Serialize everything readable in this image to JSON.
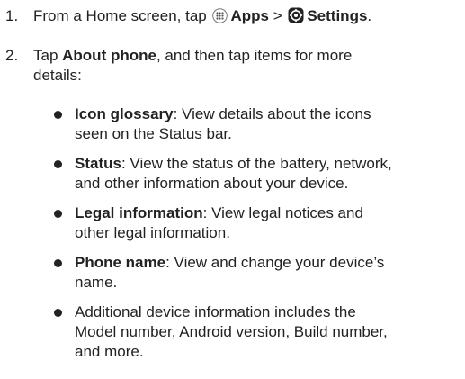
{
  "steps": [
    {
      "number": "1.",
      "text_before": "From a Home screen, tap ",
      "apps_icon": "apps-grid-icon",
      "apps_label": "Apps",
      "separator": " > ",
      "settings_icon": "settings-gear-icon",
      "settings_label": "Settings",
      "text_after": "."
    },
    {
      "number": "2.",
      "text_before": "Tap ",
      "about_label": "About phone",
      "text_after_line1": ", and then tap items for more",
      "text_line2": "details:"
    }
  ],
  "bullets": [
    {
      "title": "Icon glossary",
      "line1_rest": ": View details about the icons",
      "line2": "seen on the Status bar."
    },
    {
      "title": "Status",
      "line1_rest": ": View the status of the battery, network,",
      "line2": "and other information about your device."
    },
    {
      "title": "Legal information",
      "line1_rest": ": View legal notices and",
      "line2": "other legal information."
    },
    {
      "title": "Phone name",
      "line1_rest": ": View and change your device’s",
      "line2": "name."
    },
    {
      "line1": "Additional device information includes the",
      "line2": "Model number, Android version, Build number,",
      "line3": "and more."
    }
  ]
}
